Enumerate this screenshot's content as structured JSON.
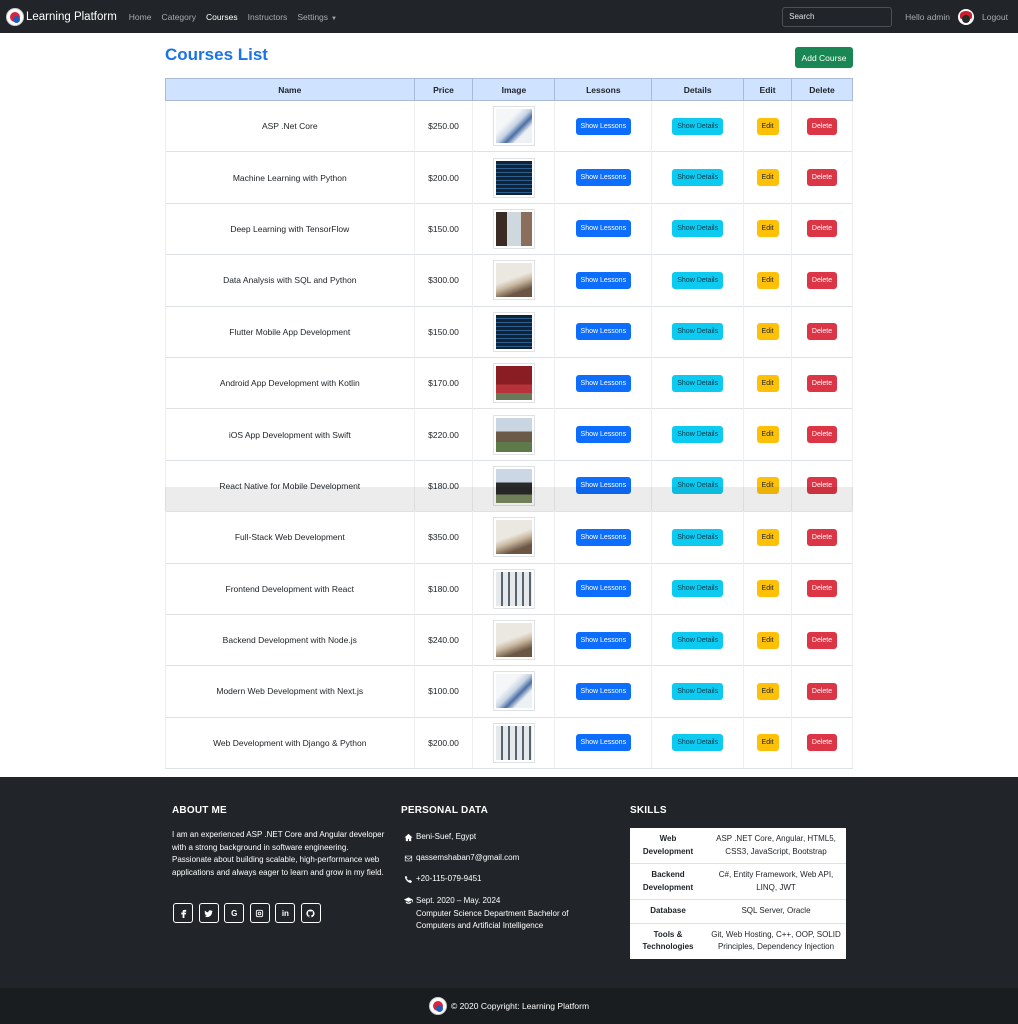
{
  "navbar": {
    "brand": "Learning Platform",
    "links": [
      "Home",
      "Category",
      "Courses",
      "Instructors",
      "Settings"
    ],
    "search_placeholder": "Search",
    "greeting": "Hello admin",
    "logout": "Logout"
  },
  "page": {
    "title": "Courses List",
    "add_button": "Add Course"
  },
  "table": {
    "headers": [
      "Name",
      "Price",
      "Image",
      "Lessons",
      "Details",
      "Edit",
      "Delete"
    ],
    "buttons": {
      "lessons": "Show Lessons",
      "details": "Show Details",
      "edit": "Edit",
      "delete": "Delete"
    },
    "rows": [
      {
        "name": "ASP .Net Core",
        "price": "$250.00",
        "image": "laptop-desk"
      },
      {
        "name": "Machine Learning with Python",
        "price": "$200.00",
        "image": "code-screen"
      },
      {
        "name": "Deep Learning with TensorFlow",
        "price": "$150.00",
        "image": "presentation"
      },
      {
        "name": "Data Analysis with SQL and Python",
        "price": "$300.00",
        "image": "paper-chart"
      },
      {
        "name": "Flutter Mobile App Development",
        "price": "$150.00",
        "image": "code-screen"
      },
      {
        "name": "Android App Development with Kotlin",
        "price": "$170.00",
        "image": "graduates"
      },
      {
        "name": "iOS App Development with Swift",
        "price": "$220.00",
        "image": "campus"
      },
      {
        "name": "React Native for Mobile Development",
        "price": "$180.00",
        "image": "graduates-2"
      },
      {
        "name": "Full-Stack Web Development",
        "price": "$350.00",
        "image": "paper-chart"
      },
      {
        "name": "Frontend Development with React",
        "price": "$180.00",
        "image": "classroom"
      },
      {
        "name": "Backend Development with Node.js",
        "price": "$240.00",
        "image": "paper-chart"
      },
      {
        "name": "Modern Web Development with Next.js",
        "price": "$100.00",
        "image": "laptop-desk"
      },
      {
        "name": "Web Development with Django & Python",
        "price": "$200.00",
        "image": "classroom"
      }
    ]
  },
  "footer": {
    "about_title": "ABOUT ME",
    "about_text": "I am an experienced ASP .NET Core and Angular developer with a strong background in software engineering. Passionate about building scalable, high-performance web applications and always eager to learn and grow in my field.",
    "social_icons": [
      "facebook-icon",
      "twitter-icon",
      "google-icon",
      "instagram-icon",
      "linkedin-icon",
      "github-icon"
    ],
    "personal_title": "PERSONAL DATA",
    "address": "Beni-Suef, Egypt",
    "email": "qassemshaban7@gmail.com",
    "phone": "+20-115-079-9451",
    "education_dates": "Sept. 2020 – May. 2024",
    "education_desc": "Computer Science Department Bachelor of Computers and Artificial Intelligence",
    "skills_title": "SKILLS",
    "skills": [
      {
        "k": "Web Development",
        "v": "ASP .NET Core, Angular, HTML5, CSS3, JavaScript, Bootstrap"
      },
      {
        "k": "Backend Development",
        "v": "C#, Entity Framework, Web API, LINQ, JWT"
      },
      {
        "k": "Database",
        "v": "SQL Server, Oracle"
      },
      {
        "k": "Tools & Technologies",
        "v": "Git, Web Hosting, C++, OOP, SOLID Principles, Dependency Injection"
      }
    ],
    "copyright": "© 2020 Copyright: Learning Platform"
  },
  "colors": {
    "navbar_bg": "#212529",
    "title": "#1a73e8",
    "header_bg": "#cfe2ff",
    "success": "#198754",
    "primary": "#0d6efd",
    "info": "#0dcaf0",
    "warning": "#ffc107",
    "danger": "#dc3545"
  }
}
